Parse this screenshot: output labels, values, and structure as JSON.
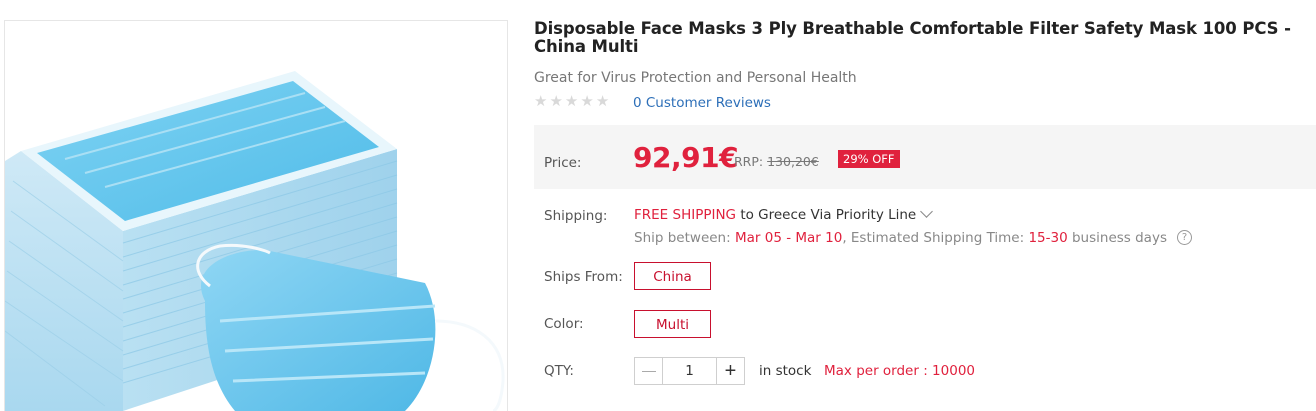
{
  "product": {
    "title": "Disposable Face Masks 3 Ply Breathable Comfortable Filter Safety Mask 100 PCS - China Multi",
    "subtitle": "Great for Virus Protection and Personal Health",
    "rating_stars": 0,
    "reviews_label": "0 Customer Reviews",
    "image_icon": "face-mask-stack-image"
  },
  "price": {
    "label": "Price:",
    "value": "92,91€",
    "rrp_label": "RRP:",
    "rrp_value": "130,20€",
    "discount_badge": "29% OFF"
  },
  "shipping": {
    "label": "Shipping:",
    "free": "FREE SHIPPING",
    "dest": " to Greece Via Priority Line",
    "between_label": "Ship between: ",
    "dates": "Mar 05 - Mar 10",
    "est_label": ", Estimated Shipping Time: ",
    "est_range": "15-30",
    "est_unit": " business days",
    "help_icon": "?"
  },
  "ships_from": {
    "label": "Ships From:",
    "value": "China"
  },
  "color": {
    "label": "Color:",
    "value": "Multi"
  },
  "qty": {
    "label": "QTY:",
    "value": "1",
    "plus": "+",
    "stock": "in stock",
    "max": "Max per order : 10000"
  },
  "colors": {
    "accent": "#e0213d",
    "link": "#2d6fb8",
    "price_bg": "#f5f5f5"
  }
}
